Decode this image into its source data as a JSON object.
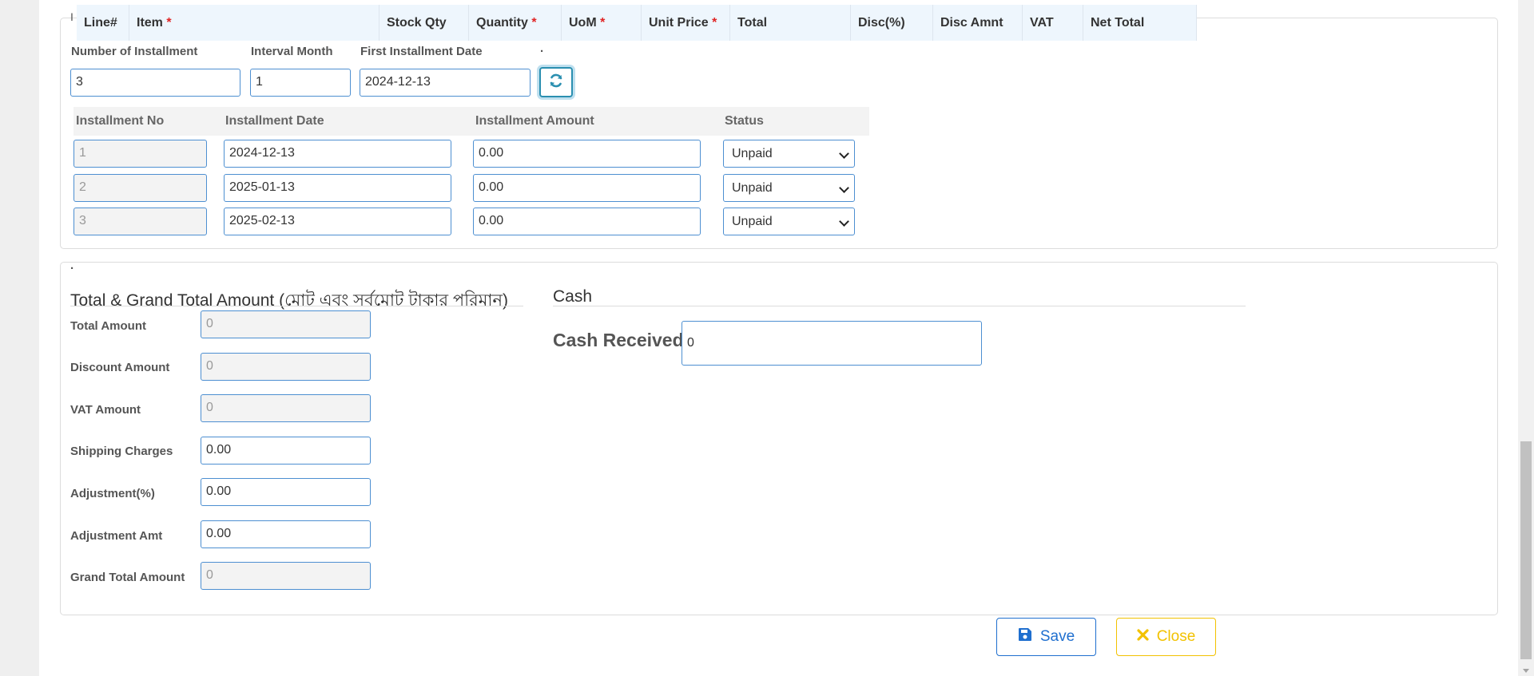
{
  "items_table": {
    "columns": [
      {
        "label": "Line#",
        "required": false
      },
      {
        "label": "Item",
        "required": true
      },
      {
        "label": "Stock Qty",
        "required": false
      },
      {
        "label": "Quantity",
        "required": true
      },
      {
        "label": "UoM",
        "required": true
      },
      {
        "label": "Unit Price",
        "required": true
      },
      {
        "label": "Total",
        "required": false
      },
      {
        "label": "Disc(%)",
        "required": false
      },
      {
        "label": "Disc Amnt",
        "required": false
      },
      {
        "label": "VAT",
        "required": false
      },
      {
        "label": "Net Total",
        "required": false
      }
    ],
    "required_marker": "*"
  },
  "installment": {
    "legend": "I",
    "dot": ".",
    "num_label": "Number of Installment",
    "num_value": "3",
    "interval_label": "Interval Month",
    "interval_value": "1",
    "first_date_label": "First Installment Date",
    "first_date_value": "2024-12-13",
    "refresh_icon": "refresh-icon",
    "headers": [
      "Installment No",
      "Installment Date",
      "Installment Amount",
      "Status"
    ],
    "rows": [
      {
        "no": "1",
        "date": "2024-12-13",
        "amount": "0.00",
        "status": "Unpaid"
      },
      {
        "no": "2",
        "date": "2025-01-13",
        "amount": "0.00",
        "status": "Unpaid"
      },
      {
        "no": "3",
        "date": "2025-02-13",
        "amount": "0.00",
        "status": "Unpaid"
      }
    ]
  },
  "totals": {
    "dot": ".",
    "title": "Total & Grand Total Amount (মোট এবং সর্বমোট টাকার পরিমান)",
    "fields": [
      {
        "label": "Total Amount",
        "value": "0",
        "readonly": true
      },
      {
        "label": "Discount Amount",
        "value": "0",
        "readonly": true
      },
      {
        "label": "VAT Amount",
        "value": "0",
        "readonly": true
      },
      {
        "label": "Shipping Charges",
        "value": "0.00",
        "readonly": false
      },
      {
        "label": "Adjustment(%)",
        "value": "0.00",
        "readonly": false
      },
      {
        "label": "Adjustment Amt",
        "value": "0.00",
        "readonly": false
      },
      {
        "label": "Grand Total Amount",
        "value": "0",
        "readonly": true
      }
    ]
  },
  "cash": {
    "title": "Cash",
    "received_label": "Cash Received",
    "received_value": "0"
  },
  "actions": {
    "save_label": "Save",
    "close_label": "Close"
  },
  "colors": {
    "primary": "#1f6fcf",
    "warning": "#f2c200",
    "info": "#2a8fb0",
    "required": "#e02424"
  }
}
